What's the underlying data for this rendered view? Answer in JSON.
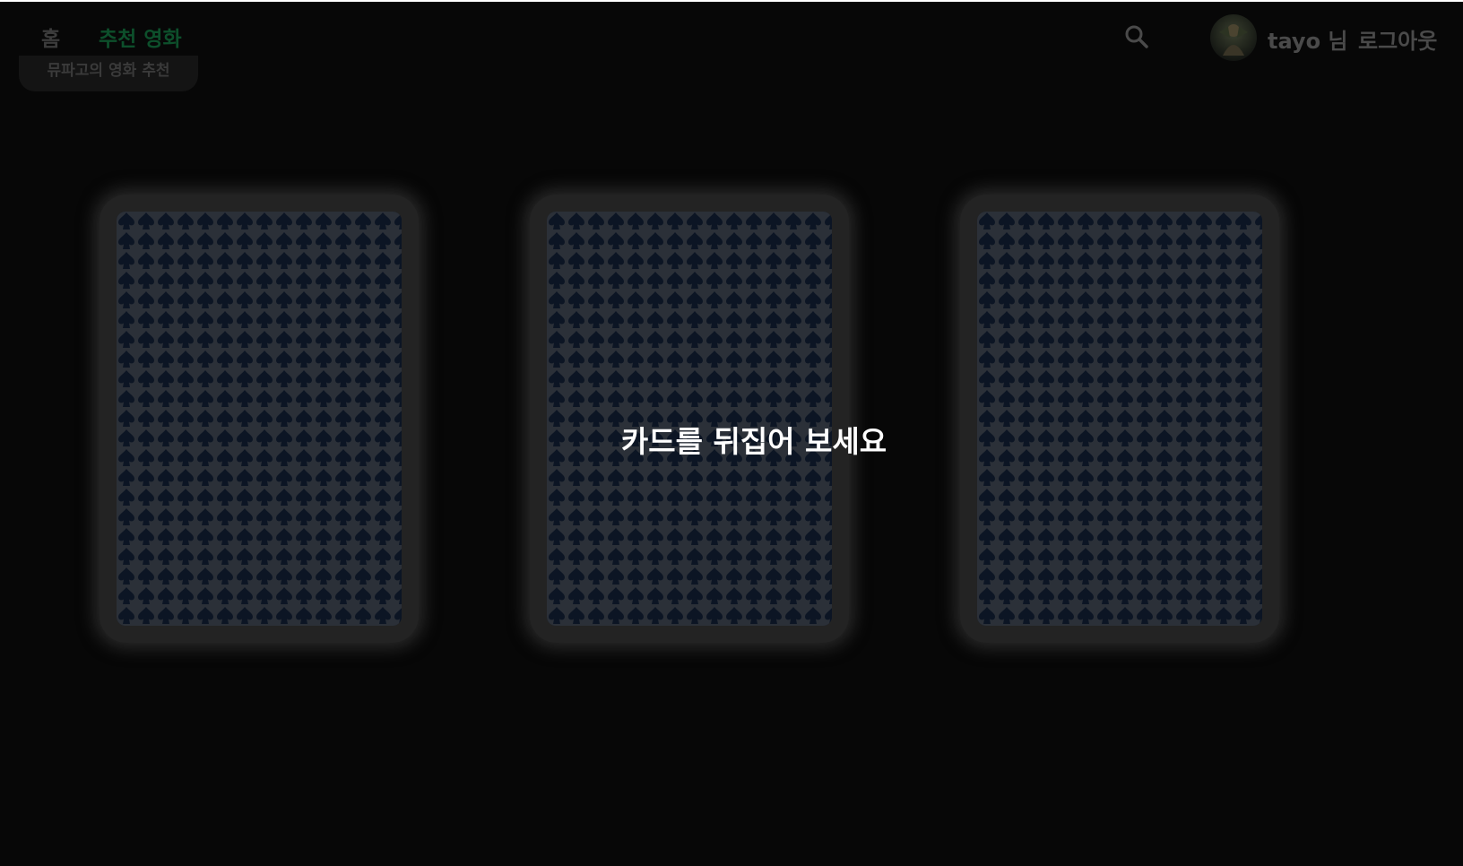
{
  "nav": {
    "home_label": "홈",
    "recommend_label": "추천 영화",
    "user_name": "tayo 님",
    "logout_label": "로그아웃"
  },
  "submenu": {
    "label": "뮤파고의 영화 추천"
  },
  "cards": [
    {
      "state": "face-down"
    },
    {
      "state": "face-down"
    },
    {
      "state": "face-down"
    }
  ],
  "hint_text": "카드를 뒤집어 보세요",
  "colors": {
    "background": "#070707",
    "card_frame": "#232323",
    "card_back": "#0c1524",
    "accent": "#0d4f2b"
  }
}
